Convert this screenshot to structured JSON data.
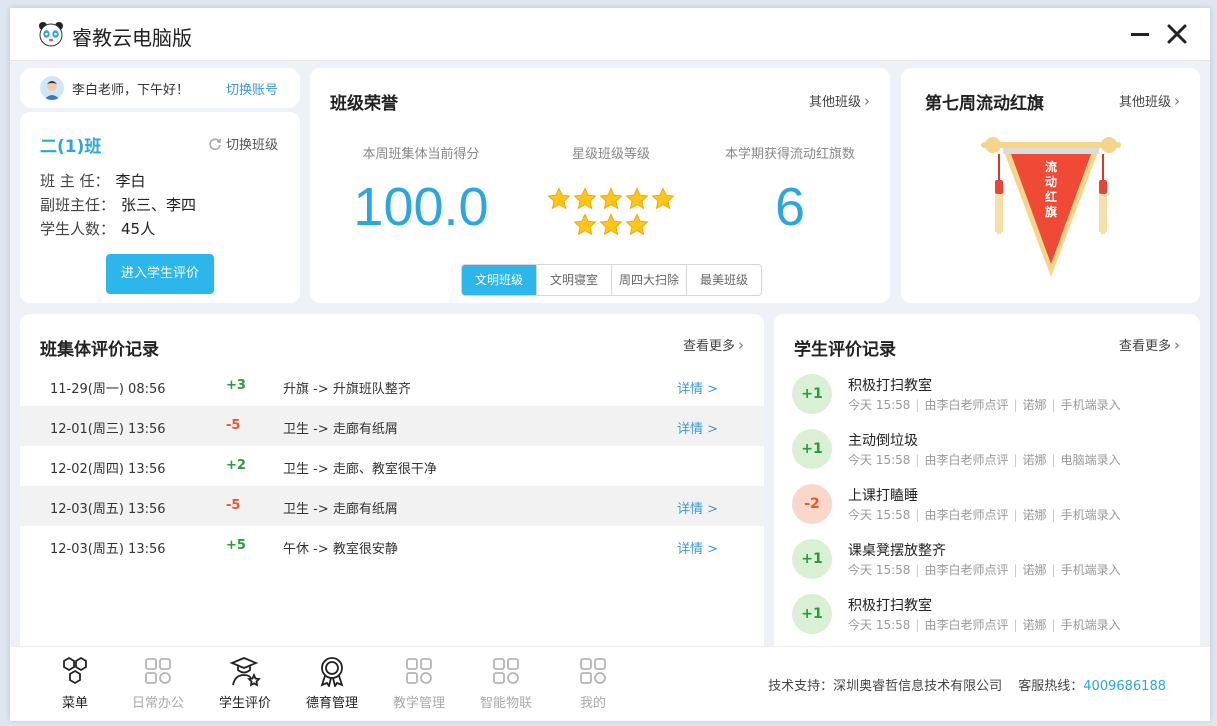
{
  "app": {
    "title": "睿教云电脑版"
  },
  "greeting": {
    "text": "李白老师，下午好！",
    "switch_account": "切换账号"
  },
  "class_card": {
    "name": "二(1)班",
    "switch_label": "切换班级",
    "head_teacher_label": "班 主 任：",
    "head_teacher": "李白",
    "deputy_label": "副班主任：",
    "deputy": "张三、李四",
    "students_label": "学生人数：",
    "students": "45人",
    "enter_button": "进入学生评价"
  },
  "honor": {
    "title": "班级荣誉",
    "other_class": "其他班级",
    "score_label": "本周班集体当前得分",
    "score": "100.0",
    "star_label": "星级班级等级",
    "star_rating": 8,
    "flag_count_label": "本学期获得流动红旗数",
    "flag_count": "6",
    "tabs": [
      "文明班级",
      "文明寝室",
      "周四大扫除",
      "最美班级"
    ]
  },
  "red_flag": {
    "title": "第七周流动红旗",
    "other_class": "其他班级",
    "flag_text": "流动红旗",
    "colors": {
      "flag": "#f04a36",
      "pole": "#f4d58a"
    }
  },
  "class_records": {
    "title": "班集体评价记录",
    "more": "查看更多",
    "rows": [
      {
        "date": "11-29(周一) 08:56",
        "score": "+3",
        "desc": "升旗 -> 升旗班队整齐",
        "detail": "详情 >"
      },
      {
        "date": "12-01(周三) 13:56",
        "score": "-5",
        "desc": "卫生 -> 走廊有纸屑",
        "detail": "详情 >"
      },
      {
        "date": "12-02(周四) 13:56",
        "score": "+2",
        "desc": "卫生 -> 走廊、教室很干净",
        "detail": ""
      },
      {
        "date": "12-03(周五) 13:56",
        "score": "-5",
        "desc": "卫生 -> 走廊有纸屑",
        "detail": "详情 >"
      },
      {
        "date": "12-03(周五) 13:56",
        "score": "+5",
        "desc": "午休 -> 教室很安静",
        "detail": "详情 >"
      }
    ]
  },
  "student_records": {
    "title": "学生评价记录",
    "more": "查看更多",
    "items": [
      {
        "score": "+1",
        "title": "积极打扫教室",
        "time": "今天 15:58",
        "by": "由李白老师点评",
        "student": "诺娜",
        "source": "手机端录入"
      },
      {
        "score": "+1",
        "title": "主动倒垃圾",
        "time": "今天 15:58",
        "by": "由李白老师点评",
        "student": "诺娜",
        "source": "电脑端录入"
      },
      {
        "score": "-2",
        "title": "上课打瞌睡",
        "time": "今天 15:58",
        "by": "由李白老师点评",
        "student": "诺娜",
        "source": "手机端录入"
      },
      {
        "score": "+1",
        "title": "课桌凳摆放整齐",
        "time": "今天 15:58",
        "by": "由李白老师点评",
        "student": "诺娜",
        "source": "手机端录入"
      },
      {
        "score": "+1",
        "title": "积极打扫教室",
        "time": "今天 15:58",
        "by": "由李白老师点评",
        "student": "诺娜",
        "source": "手机端录入"
      }
    ]
  },
  "bottom_nav": {
    "items": [
      {
        "label": "菜单",
        "icon": "menu-hex-icon",
        "active": true
      },
      {
        "label": "日常办公",
        "icon": "apps-grid-icon",
        "active": false
      },
      {
        "label": "学生评价",
        "icon": "graduate-icon",
        "active": true
      },
      {
        "label": "德育管理",
        "icon": "medal-icon",
        "active": true
      },
      {
        "label": "教学管理",
        "icon": "apps-grid-icon",
        "active": false
      },
      {
        "label": "智能物联",
        "icon": "apps-grid-icon",
        "active": false
      },
      {
        "label": "我的",
        "icon": "apps-grid-icon",
        "active": false
      }
    ],
    "support_label": "技术支持：深圳奥睿哲信息技术有限公司",
    "hotline_label": "客服热线：",
    "hotline": "4009686188"
  },
  "theme": {
    "accent": "#2cb6ec",
    "positive": "#2a9a3a",
    "negative": "#e05a2e"
  }
}
